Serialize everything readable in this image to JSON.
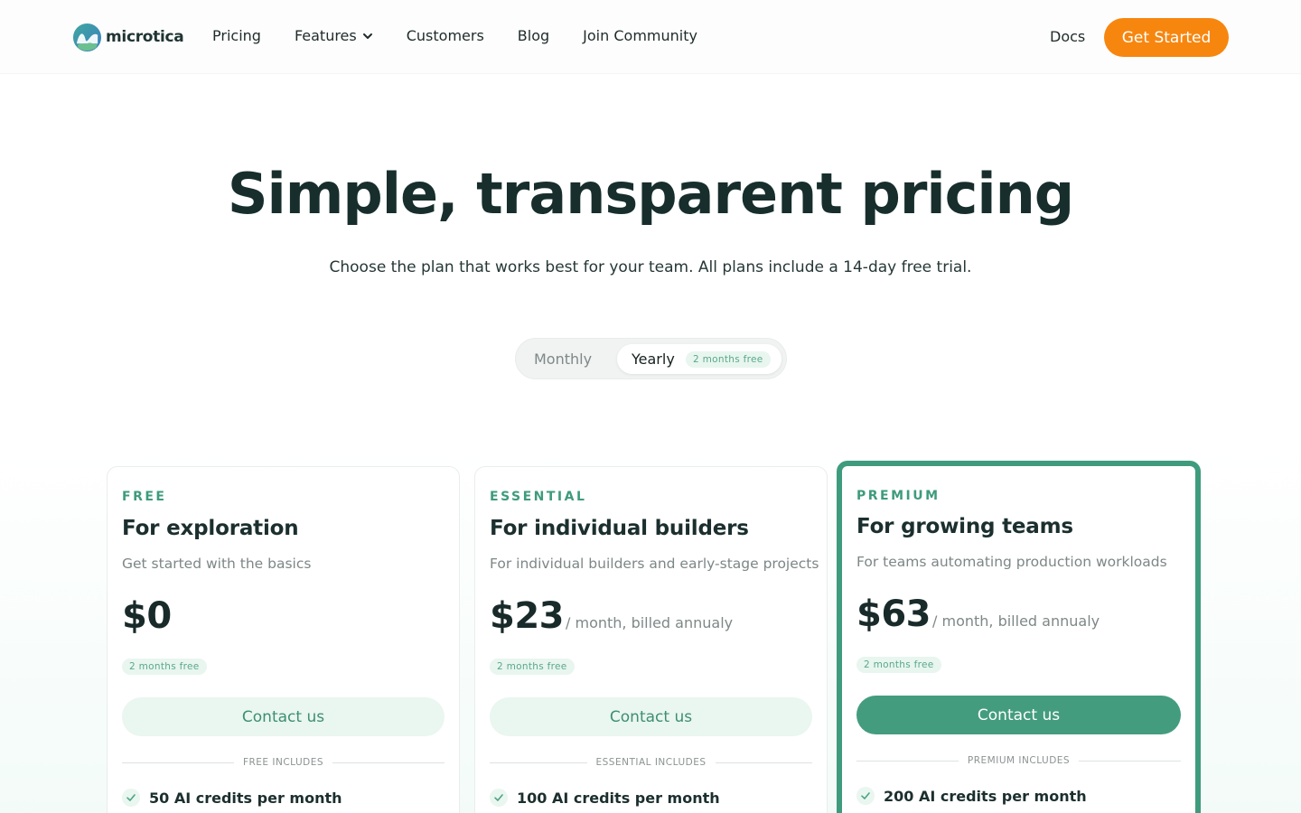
{
  "nav": {
    "logo_text": "microtica",
    "links": [
      "Pricing",
      "Features",
      "Customers",
      "Blog",
      "Join Community"
    ],
    "docs": "Docs",
    "cta": "Get Started"
  },
  "hero": {
    "title": "Simple, transparent pricing",
    "subtitle": "Choose the plan that works best for your team. All plans include a 14-day free trial."
  },
  "toggle": {
    "monthly": "Monthly",
    "yearly": "Yearly",
    "yearly_badge": "2 months free",
    "selected": "Yearly"
  },
  "plans": [
    {
      "tier": "FREE",
      "tagline": "For exploration",
      "description": "Get started with the basics",
      "price": "$0",
      "period": "",
      "badge": "2 months free",
      "button": "Contact us",
      "includes_label": "FREE INCLUDES",
      "features": [
        "50 AI credits per month"
      ]
    },
    {
      "tier": "ESSENTIAL",
      "tagline": "For individual builders",
      "description": "For individual builders and early-stage projects",
      "price": "$23",
      "period": "/ month, billed annualy",
      "badge": "2 months free",
      "button": "Contact us",
      "includes_label": "ESSENTIAL INCLUDES",
      "features": [
        "100 AI credits per month"
      ]
    },
    {
      "tier": "PREMIUM",
      "tagline": "For growing teams",
      "description": "For teams automating production workloads",
      "price": "$63",
      "period": "/ month, billed annualy",
      "badge": "2 months free",
      "button": "Contact us",
      "includes_label": "PREMIUM INCLUDES",
      "features": [
        "200 AI credits per month"
      ]
    }
  ],
  "colors": {
    "accent_orange": "#f7860f",
    "accent_green": "#3f9b7d",
    "text_dark": "#172e2c"
  }
}
